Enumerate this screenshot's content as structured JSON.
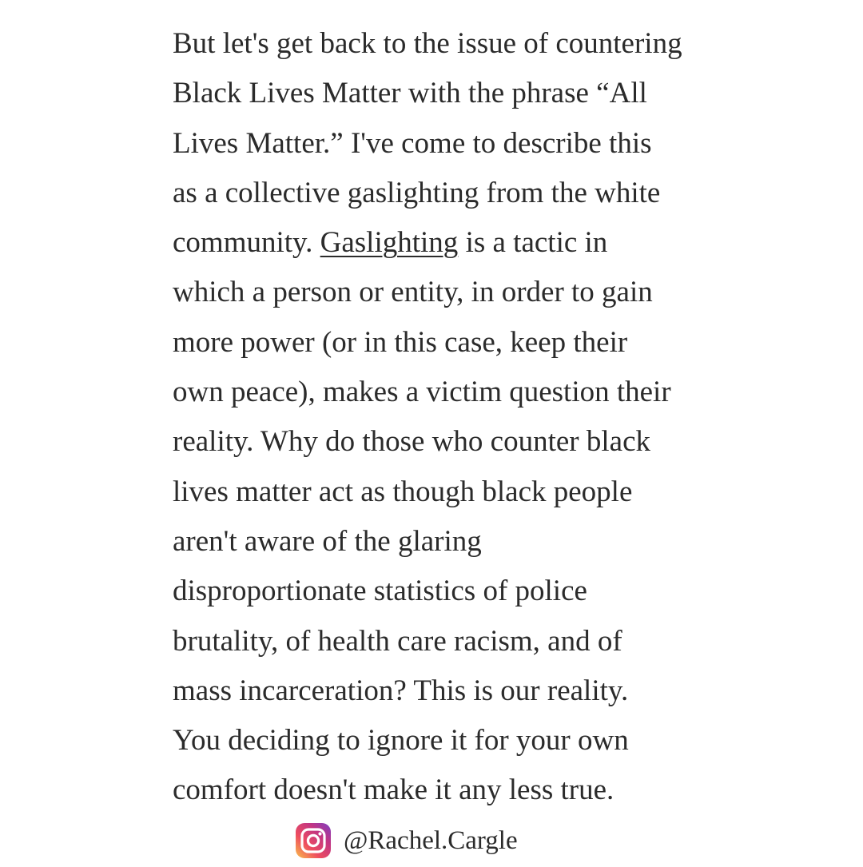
{
  "passage": {
    "lines": [
      "But let's get back to the issue of countering",
      "Black Lives Matter with the phrase “All",
      "Lives Matter.” I've come to describe this",
      "as a collective gaslighting from the white",
      {
        "before": "community. ",
        "link": "Gaslighting",
        "after": " is a tactic in"
      },
      "which a person or entity, in order to gain",
      "more power (or in this case, keep their",
      "own peace), makes a victim question their",
      "reality. Why do those who counter black",
      "lives matter act as though black people",
      "aren't aware of the glaring",
      "disproportionate statistics of police",
      "brutality, of health care racism, and of",
      "mass incarceration? This is our reality.",
      "You deciding to ignore it for your own",
      "comfort doesn't make it any less true."
    ]
  },
  "credit": {
    "icon": "instagram-icon",
    "handle": "@Rachel.Cargle"
  }
}
